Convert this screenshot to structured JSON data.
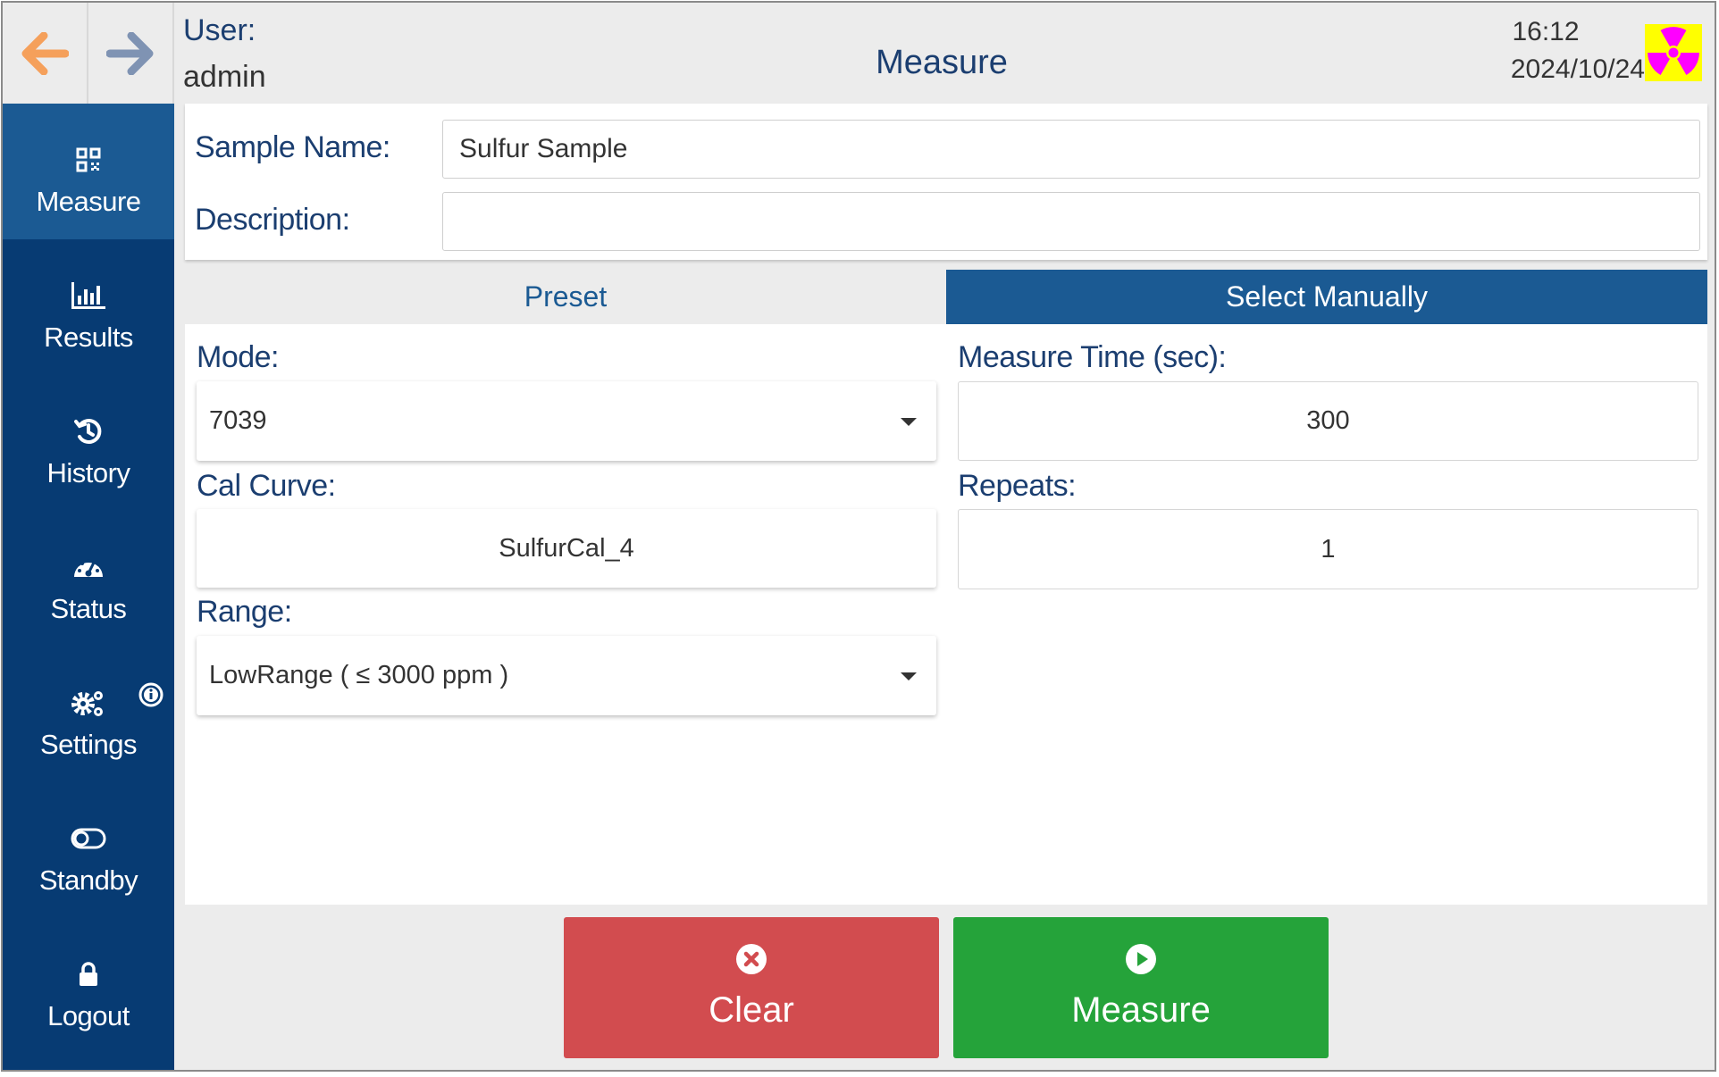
{
  "header": {
    "user_label": "User:",
    "user_name": "admin",
    "title": "Measure",
    "time": "16:12",
    "date": "2024/10/24",
    "back_icon": "arrow-left-icon",
    "forward_icon": "arrow-right-icon",
    "status_icon": "radiation-icon",
    "back_color": "#f5a05b",
    "forward_color": "#7f93b3"
  },
  "sidebar": {
    "items": [
      {
        "label": "Measure",
        "icon": "qr-code-icon",
        "active": true
      },
      {
        "label": "Results",
        "icon": "bar-chart-icon",
        "active": false
      },
      {
        "label": "History",
        "icon": "history-icon",
        "active": false
      },
      {
        "label": "Status",
        "icon": "gauge-icon",
        "active": false
      },
      {
        "label": "Settings",
        "icon": "gears-icon",
        "active": false,
        "badge_icon": "info-icon"
      },
      {
        "label": "Standby",
        "icon": "toggle-icon",
        "active": false
      },
      {
        "label": "Logout",
        "icon": "lock-icon",
        "active": false
      }
    ]
  },
  "sample": {
    "name_label": "Sample Name:",
    "name_value": "Sulfur Sample",
    "description_label": "Description:",
    "description_value": ""
  },
  "tabs": {
    "preset": "Preset",
    "manual": "Select Manually",
    "active": "manual"
  },
  "params": {
    "mode_label": "Mode:",
    "mode_value": "7039",
    "cal_curve_label": "Cal Curve:",
    "cal_curve_value": "SulfurCal_4",
    "range_label": "Range:",
    "range_value": "LowRange ( ≤ 3000 ppm )",
    "measure_time_label": "Measure Time (sec):",
    "measure_time_value": "300",
    "repeats_label": "Repeats:",
    "repeats_value": "1"
  },
  "actions": {
    "clear_label": "Clear",
    "clear_icon": "close-circle-icon",
    "measure_label": "Measure",
    "measure_icon": "play-circle-icon"
  },
  "colors": {
    "sidebar": "#073b73",
    "sidebar_active": "#1b5a93",
    "tab_active": "#1b5a93",
    "text_accent": "#1b3e70",
    "clear": "#d24c4f",
    "measure": "#25a33a",
    "hazard_bg": "#ffff00",
    "hazard_fg": "#ff00ff"
  }
}
